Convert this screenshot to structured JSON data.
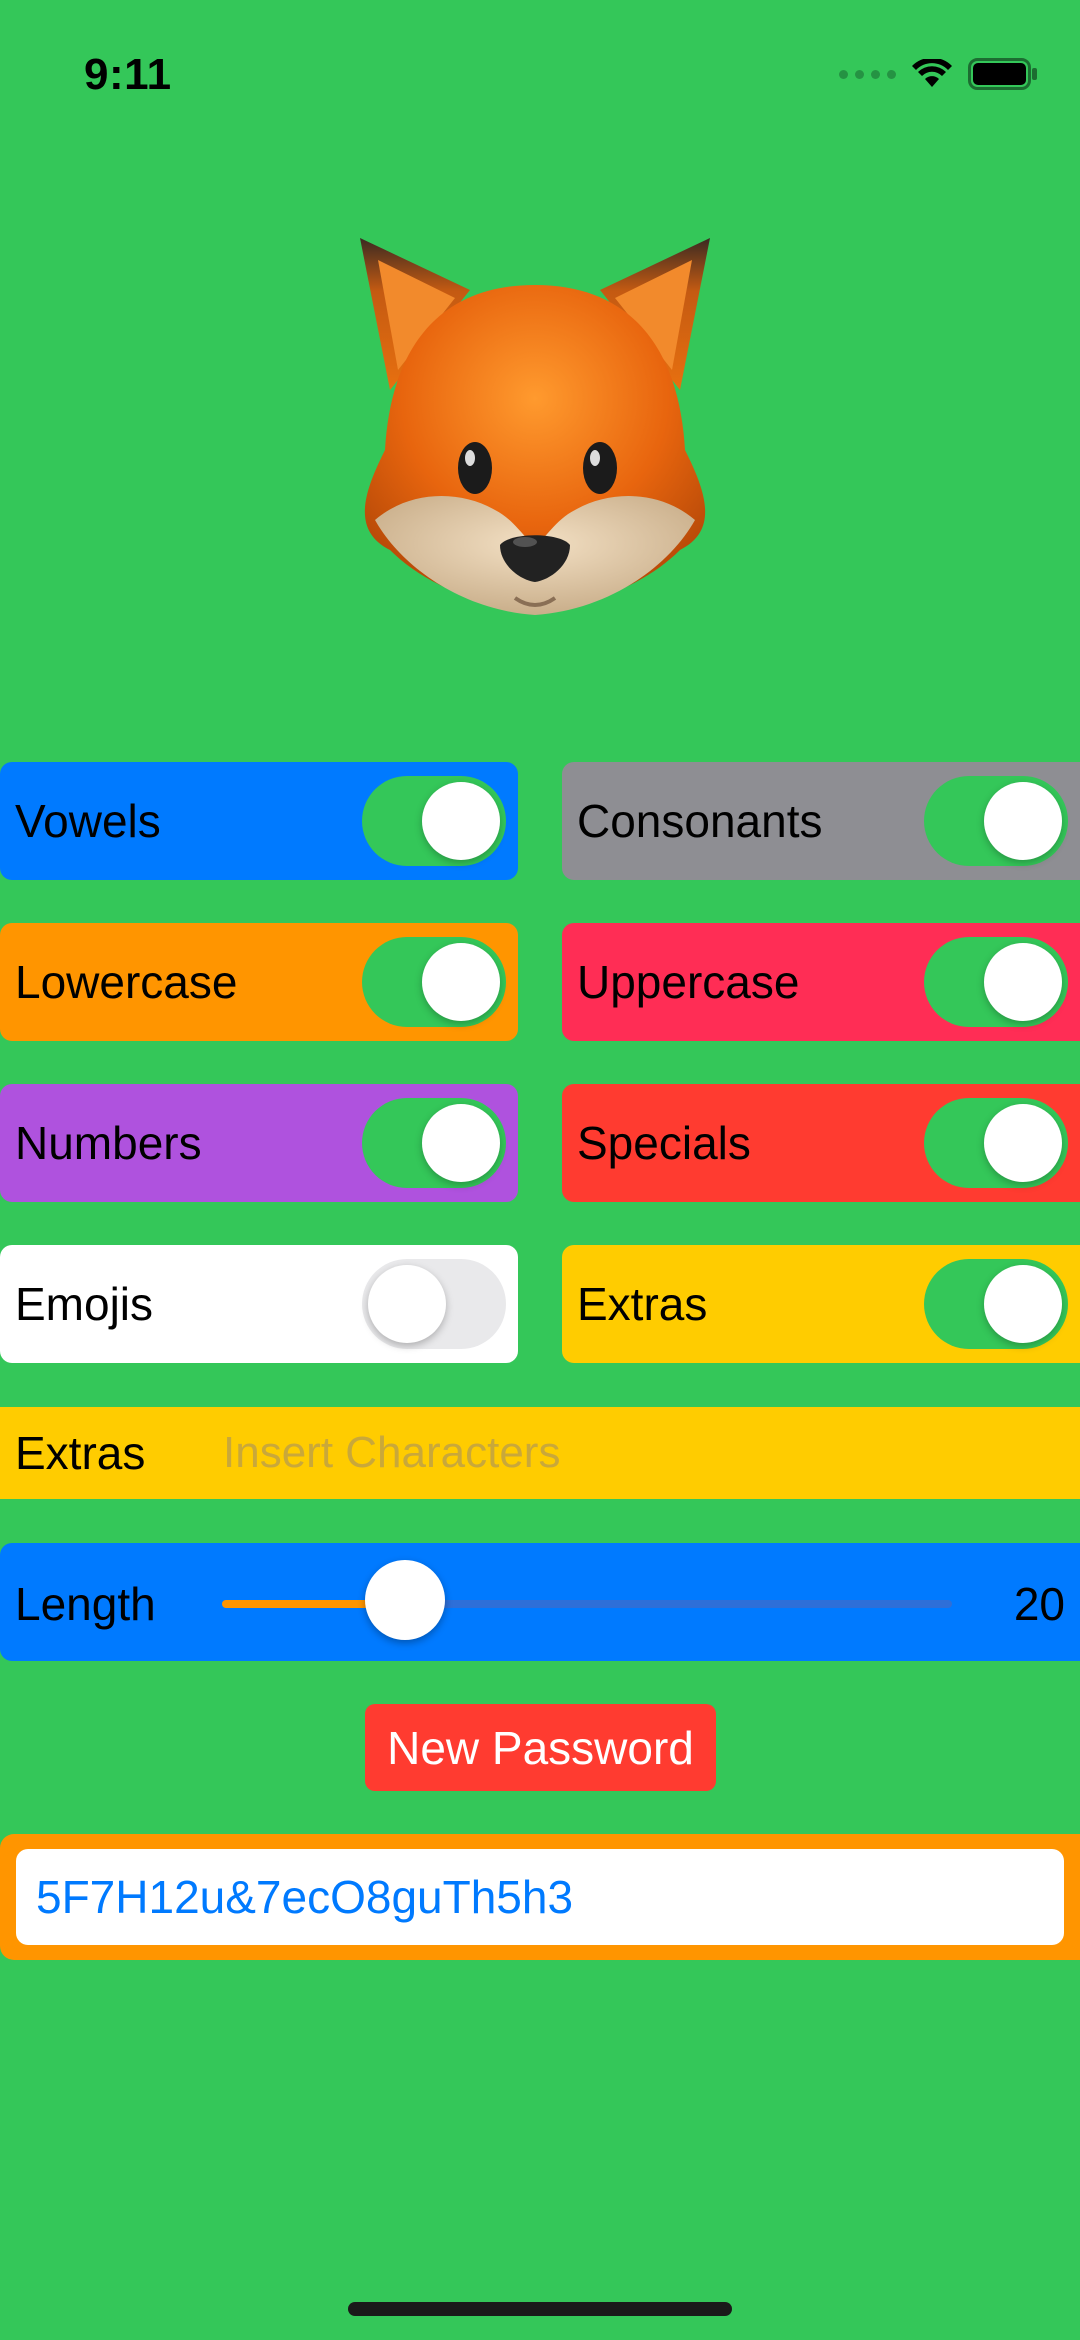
{
  "status_bar": {
    "time": "9:11",
    "icons": [
      "signal-dots-icon",
      "wifi-icon",
      "battery-icon"
    ]
  },
  "header_image": "fox-emoji-icon",
  "toggles": [
    {
      "label": "Vowels",
      "on": true,
      "color": "#007AFF"
    },
    {
      "label": "Consonants",
      "on": true,
      "color": "#8E8E93"
    },
    {
      "label": "Lowercase",
      "on": true,
      "color": "#FF9500"
    },
    {
      "label": "Uppercase",
      "on": true,
      "color": "#FF2D55"
    },
    {
      "label": "Numbers",
      "on": true,
      "color": "#AF52DE"
    },
    {
      "label": "Specials",
      "on": true,
      "color": "#FF3B30"
    },
    {
      "label": "Emojis",
      "on": false,
      "color": "#FFFFFF"
    },
    {
      "label": "Extras",
      "on": true,
      "color": "#FFCC00"
    }
  ],
  "extras_field": {
    "label": "Extras",
    "placeholder": "Insert Characters",
    "value": ""
  },
  "length": {
    "label": "Length",
    "value": "20",
    "slider_fraction": 0.25
  },
  "new_password_button": "New Password",
  "password": "5F7H12u&7ecO8guTh5h3",
  "colors": {
    "background": "#34C759",
    "toggle_on": "#34C759",
    "slider_fill": "#FF9500",
    "password_frame": "#FF9500",
    "password_text": "#007AFF"
  }
}
